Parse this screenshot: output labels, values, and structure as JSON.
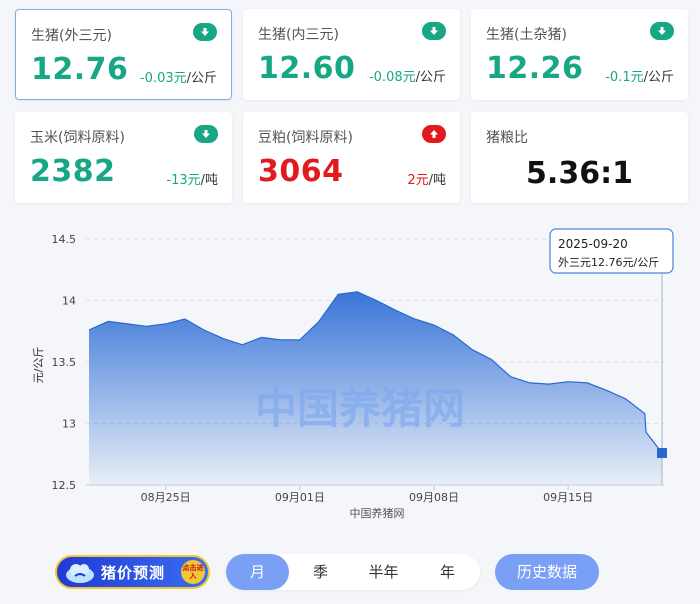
{
  "cards": [
    {
      "name": "生猪(外三元)",
      "price": "12.76",
      "change": "-0.03元",
      "unit": "/公斤",
      "trend": "down",
      "selected": true
    },
    {
      "name": "生猪(内三元)",
      "price": "12.60",
      "change": "-0.08元",
      "unit": "/公斤",
      "trend": "down",
      "selected": false
    },
    {
      "name": "生猪(土杂猪)",
      "price": "12.26",
      "change": "-0.1元",
      "unit": "/公斤",
      "trend": "down",
      "selected": false
    },
    {
      "name": "玉米(饲料原料)",
      "price": "2382",
      "change": "-13元",
      "unit": "/吨",
      "trend": "down",
      "selected": false
    },
    {
      "name": "豆粕(饲料原料)",
      "price": "3064",
      "change": "2元",
      "unit": "/吨",
      "trend": "up",
      "selected": false
    },
    {
      "name": "猪粮比",
      "price": "5.36:1",
      "change": "",
      "unit": "",
      "trend": "none",
      "selected": false
    }
  ],
  "colors": {
    "down": "#17a785",
    "up": "#e2191d",
    "area": "#2f6fd6",
    "accent": "#7aa0f5"
  },
  "chart_data": {
    "type": "area",
    "ylabel": "元/公斤",
    "xlabel": "中国养猪网",
    "watermark": "中国养猪网",
    "ylim": [
      12.5,
      14.5
    ],
    "yticks": [
      "14.5",
      "14",
      "13.5",
      "13",
      "12.5"
    ],
    "ytick_values": [
      14.5,
      14,
      13.5,
      13,
      12.5
    ],
    "xticks": [
      {
        "label": "08月25日",
        "day": 24
      },
      {
        "label": "09月01日",
        "day": 31
      },
      {
        "label": "09月08日",
        "day": 38
      },
      {
        "label": "09月15日",
        "day": 45
      }
    ],
    "x_start": "2025-08-21",
    "x_end": "2025-09-20",
    "series": [
      {
        "values": [
          {
            "date": "2025-08-21",
            "value": 13.76
          },
          {
            "date": "2025-08-22",
            "value": 13.83
          },
          {
            "date": "2025-08-23",
            "value": 13.81
          },
          {
            "date": "2025-08-24",
            "value": 13.79
          },
          {
            "date": "2025-08-25",
            "value": 13.81
          },
          {
            "date": "2025-08-26",
            "value": 13.85
          },
          {
            "date": "2025-08-27",
            "value": 13.76
          },
          {
            "date": "2025-08-28",
            "value": 13.69
          },
          {
            "date": "2025-08-29",
            "value": 13.64
          },
          {
            "date": "2025-08-30",
            "value": 13.7
          },
          {
            "date": "2025-08-31",
            "value": 13.68
          },
          {
            "date": "2025-09-01",
            "value": 13.68
          },
          {
            "date": "2025-09-02",
            "value": 13.83
          },
          {
            "date": "2025-09-03",
            "value": 14.05
          },
          {
            "date": "2025-09-04",
            "value": 14.07
          },
          {
            "date": "2025-09-05",
            "value": 14.0
          },
          {
            "date": "2025-09-06",
            "value": 13.92
          },
          {
            "date": "2025-09-07",
            "value": 13.85
          },
          {
            "date": "2025-09-08",
            "value": 13.8
          },
          {
            "date": "2025-09-09",
            "value": 13.72
          },
          {
            "date": "2025-09-10",
            "value": 13.6
          },
          {
            "date": "2025-09-11",
            "value": 13.52
          },
          {
            "date": "2025-09-12",
            "value": 13.38
          },
          {
            "date": "2025-09-13",
            "value": 13.33
          },
          {
            "date": "2025-09-14",
            "value": 13.32
          },
          {
            "date": "2025-09-15",
            "value": 13.34
          },
          {
            "date": "2025-09-16",
            "value": 13.33
          },
          {
            "date": "2025-09-17",
            "value": 13.27
          },
          {
            "date": "2025-09-18",
            "value": 13.2
          },
          {
            "date": "2025-09-19",
            "value": 13.08
          },
          {
            "date": "2025-09-20",
            "value": 12.93
          }
        ]
      }
    ],
    "last_point": {
      "date": "2025-09-20",
      "value": 12.76
    },
    "tooltip": {
      "date": "2025-09-20",
      "text": "外三元12.76元/公斤"
    }
  },
  "controls": {
    "predict_label": "猪价预测",
    "enter_label": "点击进入",
    "tabs": [
      "月",
      "季",
      "半年",
      "年"
    ],
    "active_tab": "月",
    "history_label": "历史数据"
  }
}
